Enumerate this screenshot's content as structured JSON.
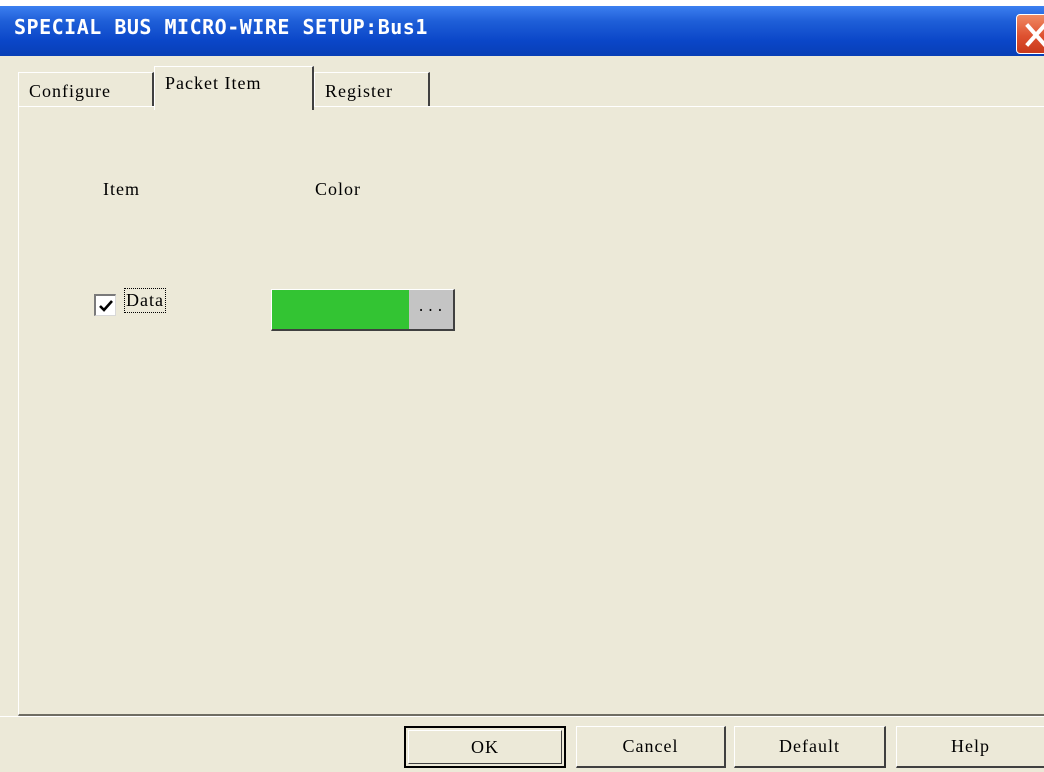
{
  "window": {
    "title": "SPECIAL BUS MICRO-WIRE SETUP:Bus1",
    "close_icon": "close-icon"
  },
  "tabs": [
    {
      "label": "Configure",
      "active": false
    },
    {
      "label": "Packet Item",
      "active": true
    },
    {
      "label": "Register",
      "active": false
    }
  ],
  "packet_item": {
    "column_item": "Item",
    "column_color": "Color",
    "rows": [
      {
        "label": "Data",
        "checked": true,
        "color": "#33c433",
        "picker_label": "..."
      }
    ]
  },
  "buttons": {
    "ok": "OK",
    "cancel": "Cancel",
    "default": "Default",
    "help": "Help"
  },
  "colors": {
    "titlebar": "#0a46c8",
    "dialog_bg": "#ece9d8",
    "close_button": "#de5130",
    "swatch": "#33c433"
  }
}
